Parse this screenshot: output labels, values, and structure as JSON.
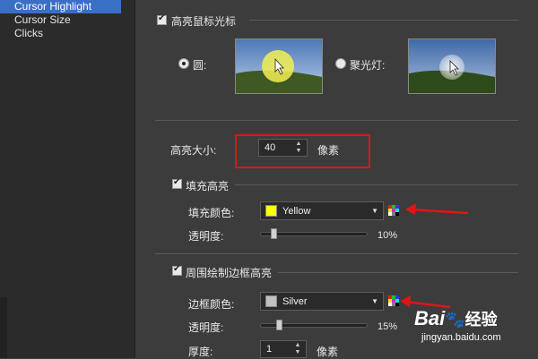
{
  "sidebar": {
    "items": [
      {
        "label": "Cursor Highlight",
        "selected": true
      },
      {
        "label": "Cursor Size",
        "selected": false
      },
      {
        "label": "Clicks",
        "selected": false
      }
    ]
  },
  "highlight": {
    "enable_label": "高亮鼠标光标",
    "enabled": true,
    "shape_circle_label": "圆:",
    "shape_spotlight_label": "聚光灯:",
    "selected_shape": "circle"
  },
  "size": {
    "label": "高亮大小:",
    "value": "40",
    "unit": "像素"
  },
  "fill": {
    "enable_label": "填充高亮",
    "enabled": true,
    "color_label": "填充颜色:",
    "color_value": "Yellow",
    "color_hex": "#ffff00",
    "opacity_label": "透明度:",
    "opacity_value": "10%",
    "opacity_fraction": 0.1
  },
  "border": {
    "enable_label": "周围绘制边框高亮",
    "enabled": true,
    "color_label": "边框颜色:",
    "color_value": "Silver",
    "color_hex": "#c0c0c0",
    "opacity_label": "透明度:",
    "opacity_value": "15%",
    "opacity_fraction": 0.15,
    "thickness_label": "厚度:",
    "thickness_value": "1",
    "thickness_unit": "像素"
  },
  "watermark": {
    "brand": "Bai",
    "brand_suffix": "经验",
    "url": "jingyan.baidu.com"
  },
  "colors": {
    "annotation_red": "#e01515",
    "selection_blue": "#3a6fc6"
  }
}
